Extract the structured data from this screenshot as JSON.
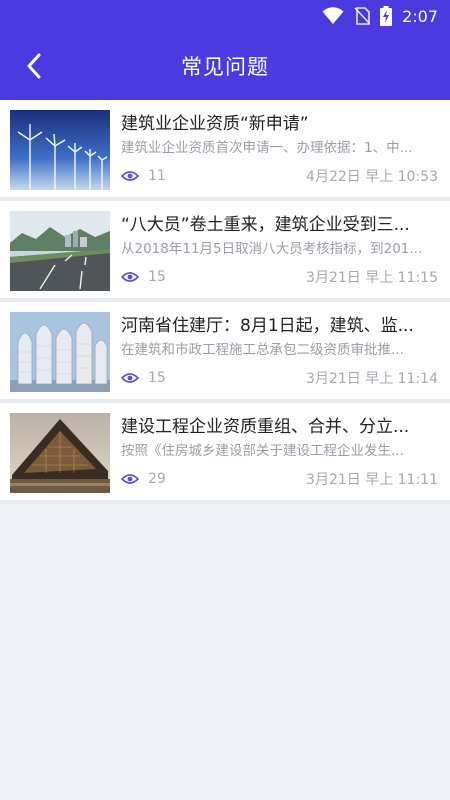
{
  "status_bar": {
    "time": "2:07"
  },
  "app_bar": {
    "title": "常见问题",
    "back_icon": "chevron-left-icon"
  },
  "articles": [
    {
      "title": "建筑业企业资质“新申请”",
      "summary": "建筑业企业资质首次申请一、办理依据：1、中...",
      "views": "11",
      "date": "4月22日 早上 10:53",
      "thumbnail": "wind-turbines-image"
    },
    {
      "title": "“八大员”卷土重来，建筑企业受到三...",
      "summary": "从2018年11月5日取消八大员考核指标，到201...",
      "views": "15",
      "date": "3月21日 早上 11:15",
      "thumbnail": "highway-image"
    },
    {
      "title": "河南省住建厅：8月1日起，建筑、监...",
      "summary": "在建筑和市政工程施工总承包二级资质审批推...",
      "views": "15",
      "date": "3月21日 早上 11:14",
      "thumbnail": "towers-image"
    },
    {
      "title": "建设工程企业资质重组、合并、分立...",
      "summary": "按照《住房城乡建设部关于建设工程企业发生...",
      "views": "29",
      "date": "3月21日 早上 11:11",
      "thumbnail": "modern-building-image"
    }
  ],
  "colors": {
    "primary": "#4a3be0",
    "eye_icon": "#5a4fd0",
    "background": "#eef1f5"
  }
}
